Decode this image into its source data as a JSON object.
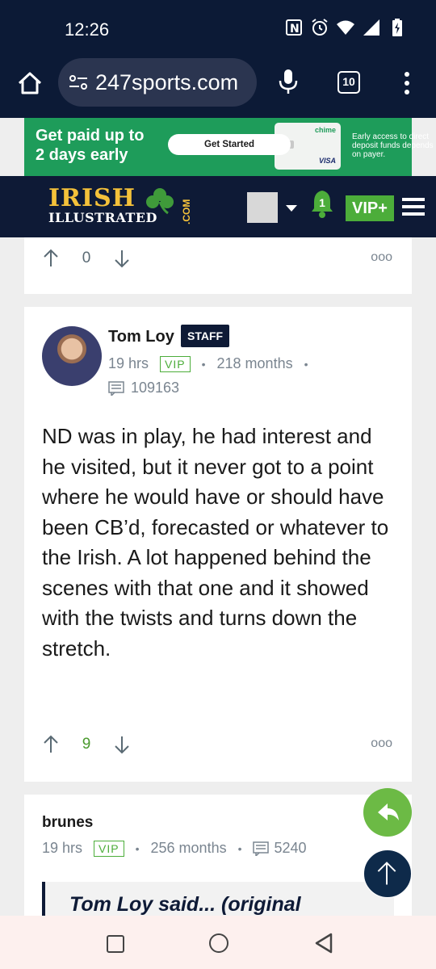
{
  "status": {
    "time": "12:26"
  },
  "browser": {
    "url": "247sports.com",
    "tab_count": "10"
  },
  "ad": {
    "headline_1": "Get paid up to",
    "headline_2": "2 days early",
    "cta": "Get Started",
    "card_brand": "chime",
    "card_network": "VISA",
    "fine_print": "Early access to direct deposit funds depends on payer."
  },
  "site": {
    "logo_line1": "IRISH",
    "logo_line2": "ILLUSTRATED",
    "logo_com": ".COM",
    "notifications": "1",
    "vip_label": "VIP+"
  },
  "prev_post": {
    "votes": "0",
    "more": "ooo"
  },
  "post": {
    "author": "Tom Loy",
    "role_badge": "STAFF",
    "time_ago": "19 hrs",
    "vip": "VIP",
    "tenure": "218 months",
    "post_count": "109163",
    "body": "ND was in play, he had interest and he visited, but it never got to a point where he would have or should have been CB’d, forecasted or whatever to the Irish. A lot happened behind the scenes with that one and it showed with the twists and turns down the stretch.",
    "votes": "9",
    "more": "ooo"
  },
  "reply": {
    "author": "brunes",
    "time_ago": "19 hrs",
    "vip": "VIP",
    "tenure": "256 months",
    "post_count": "5240",
    "quote": "Tom Loy said... (original"
  },
  "colors": {
    "navy": "#0e1a36",
    "green": "#4cad3a",
    "ad_green": "#1e9c5a"
  }
}
